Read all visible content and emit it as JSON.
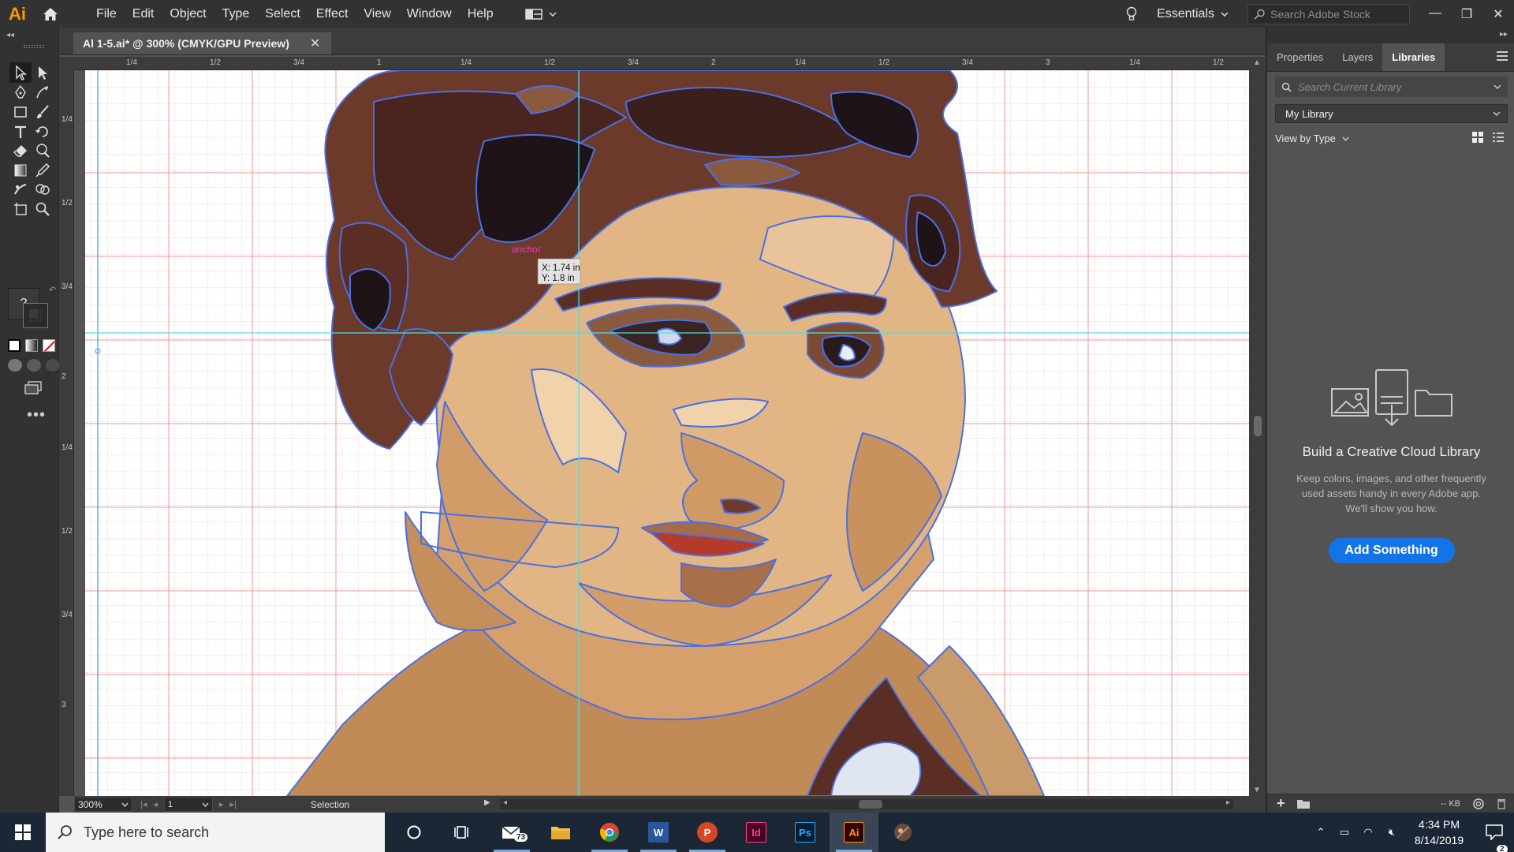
{
  "app": {
    "logo_text": "Ai",
    "menu": [
      "File",
      "Edit",
      "Object",
      "Type",
      "Select",
      "Effect",
      "View",
      "Window",
      "Help"
    ],
    "workspace": "Essentials",
    "stock_search_placeholder": "Search Adobe Stock",
    "window_controls": [
      "—",
      "❐",
      "✕"
    ]
  },
  "document": {
    "tab_title": "Al 1-5.ai* @ 300% (CMYK/GPU Preview)",
    "close_glyph": "✕",
    "cursor_label": "anchor",
    "readout_x": "X: 1.74 in",
    "readout_y": "Y: 1.8 in"
  },
  "rulers": {
    "h_labels": [
      "1/4",
      "1/2",
      "3/4",
      "1",
      "1/4",
      "1/2",
      "3/4",
      "2",
      "1/4",
      "1/2",
      "3/4",
      "3",
      "1/4",
      "1/2"
    ],
    "v_labels": [
      "1/4",
      "1/2",
      "3/4",
      "2",
      "1/4",
      "1/2",
      "3/4",
      "3"
    ]
  },
  "status": {
    "zoom": "300%",
    "page": "1",
    "mode": "Selection"
  },
  "tools": {
    "fill_stroke_label": "?"
  },
  "right_panel": {
    "tabs": [
      "Properties",
      "Layers",
      "Libraries"
    ],
    "active_tab": "Libraries",
    "search_placeholder": "Search Current Library",
    "library": "My Library",
    "view_by": "View by Type",
    "empty_title": "Build a Creative Cloud Library",
    "empty_desc": "Keep colors, images, and other frequently used assets handy in every Adobe app. We'll show you how.",
    "add_button": "Add Something",
    "footer_kb": "-- KB"
  },
  "taskbar": {
    "search_placeholder": "Type here to search",
    "mail_badge": "73",
    "time": "4:34 PM",
    "date": "8/14/2019",
    "notif_count": "2",
    "apps": [
      {
        "name": "word",
        "label": "W",
        "color": "#2b579a"
      },
      {
        "name": "powerpoint",
        "label": "P",
        "color": "#d24726"
      },
      {
        "name": "indesign",
        "label": "Id",
        "color": "#49021f"
      },
      {
        "name": "photoshop",
        "label": "Ps",
        "color": "#001e36"
      },
      {
        "name": "illustrator",
        "label": "Ai",
        "color": "#330000"
      }
    ]
  },
  "colors": {
    "accent": "#1473e6",
    "ai_orange": "#ff9a00",
    "path_outline": "#4a6fe3",
    "guide_cyan": "#4de0e8",
    "grid_pink": "#f6b8b8",
    "hair_dark": "#4a2520",
    "skin_light": "#e2b585",
    "skin_mid": "#c99060"
  }
}
